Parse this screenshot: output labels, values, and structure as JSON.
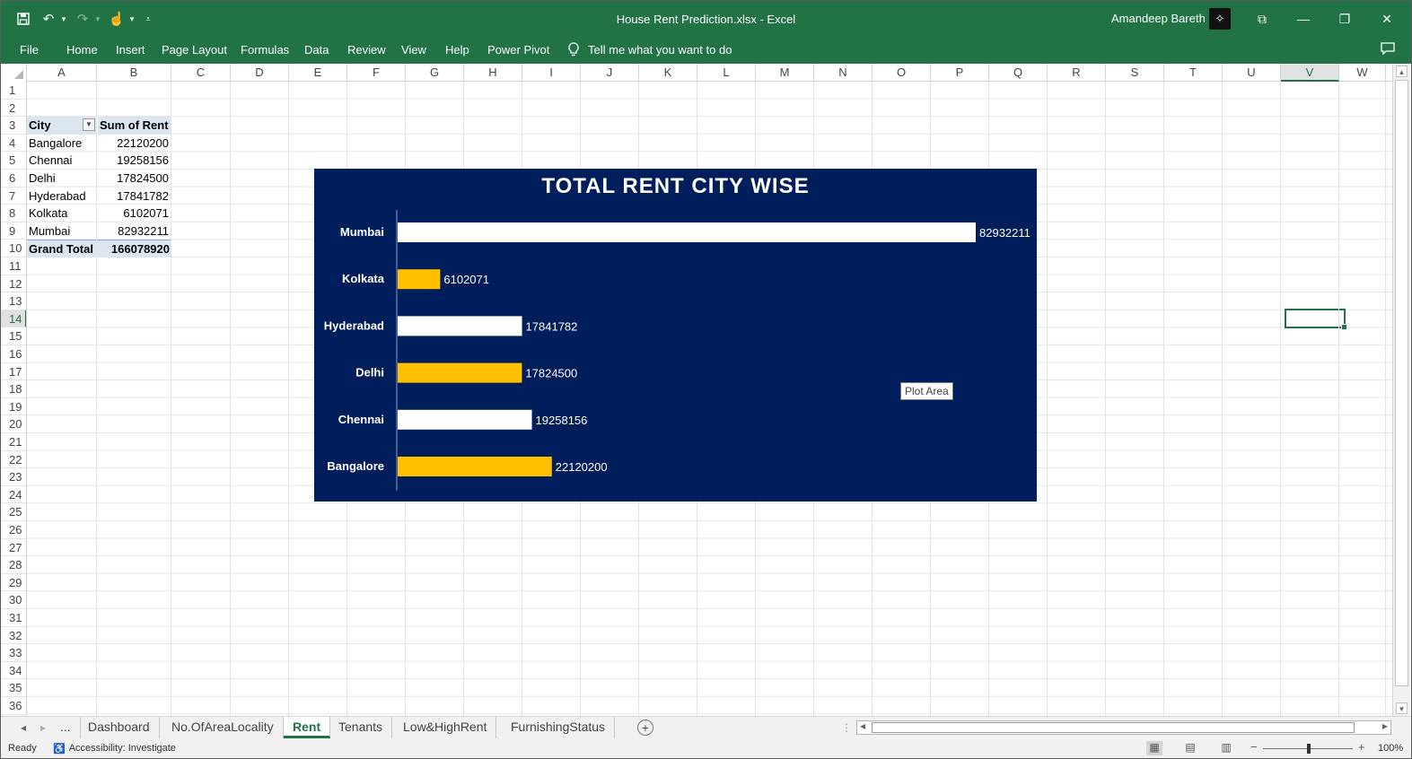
{
  "window": {
    "title": "House Rent Prediction.xlsx  -  Excel",
    "user": "Amandeep Bareth",
    "controls": {
      "restore_ribbon": "⧉",
      "minimize": "—",
      "restore": "❐",
      "close": "✕"
    }
  },
  "quick_access": {
    "save_icon": "save-icon",
    "undo_icon": "undo-icon",
    "redo_icon": "redo-icon",
    "touch_icon": "touch-mode-icon"
  },
  "ribbon": {
    "tabs": [
      "File",
      "Home",
      "Insert",
      "Page Layout",
      "Formulas",
      "Data",
      "Review",
      "View",
      "Help",
      "Power Pivot"
    ],
    "tell_me": "Tell me what you want to do"
  },
  "columns": [
    "A",
    "B",
    "C",
    "D",
    "E",
    "F",
    "G",
    "H",
    "I",
    "J",
    "K",
    "L",
    "M",
    "N",
    "O",
    "P",
    "Q",
    "R",
    "S",
    "T",
    "U",
    "V",
    "W"
  ],
  "selected_column": "V",
  "rows": [
    "1",
    "2",
    "3",
    "4",
    "5",
    "6",
    "7",
    "8",
    "9",
    "10",
    "11",
    "12",
    "13",
    "14",
    "15",
    "16",
    "17",
    "18",
    "19",
    "20",
    "21",
    "22",
    "23",
    "24",
    "25",
    "26",
    "27",
    "28",
    "29",
    "30",
    "31",
    "32",
    "33",
    "34",
    "35",
    "36"
  ],
  "selected_row": "14",
  "pivot": {
    "header_city": "City",
    "header_sum": "Sum of Rent",
    "rows": [
      {
        "city": "Bangalore",
        "rent": "22120200"
      },
      {
        "city": "Chennai",
        "rent": "19258156"
      },
      {
        "city": "Delhi",
        "rent": "17824500"
      },
      {
        "city": "Hyderabad",
        "rent": "17841782"
      },
      {
        "city": "Kolkata",
        "rent": "6102071"
      },
      {
        "city": "Mumbai",
        "rent": "82932211"
      }
    ],
    "total_label": "Grand Total",
    "total_value": "166078920"
  },
  "chart_data": {
    "type": "bar",
    "orientation": "horizontal",
    "title": "TOTAL RENT CITY WISE",
    "categories": [
      "Mumbai",
      "Kolkata",
      "Hyderabad",
      "Delhi",
      "Chennai",
      "Bangalore"
    ],
    "values": [
      82932211,
      6102071,
      17841782,
      17824500,
      19258156,
      22120200
    ],
    "bar_colors": [
      "#ffffff",
      "#ffc000",
      "#ffffff",
      "#ffc000",
      "#ffffff",
      "#ffc000"
    ],
    "background": "#001d5c",
    "data_labels": true,
    "grid": false,
    "xlim": [
      0,
      82932211
    ]
  },
  "tooltip": "Plot Area",
  "sheets": {
    "nav_more": "...",
    "tabs": [
      "Dashboard",
      "No.OfAreaLocality",
      "Rent",
      "Tenants",
      "Low&HighRent",
      "FurnishingStatus"
    ],
    "active": "Rent"
  },
  "status": {
    "ready": "Ready",
    "accessibility": "Accessibility: Investigate",
    "zoom": "100%"
  },
  "colors": {
    "excel_green": "#217346",
    "pivot_header": "#dce6f1"
  }
}
